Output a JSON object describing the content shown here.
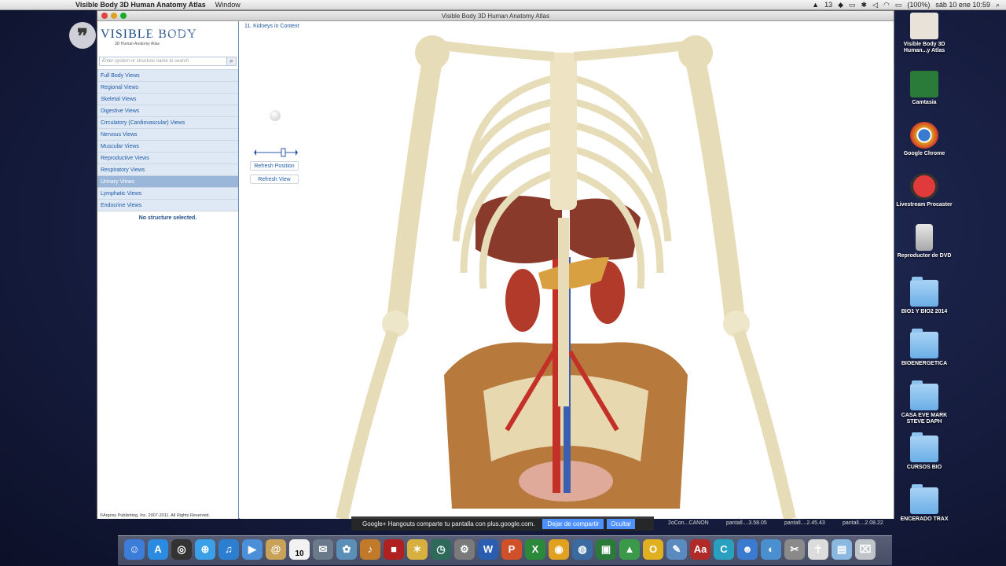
{
  "menubar": {
    "app_name": "Visible Body 3D Human Anatomy Atlas",
    "menu_window": "Window",
    "badge_count": "13",
    "battery": "(100%)",
    "datetime": "sáb 10 ene  10:59"
  },
  "window": {
    "title": "Visible Body 3D Human Anatomy Atlas"
  },
  "sidebar": {
    "logo_title": "VISIBLE BODY",
    "logo_subtitle": "3D Human Anatomy Atlas",
    "search_placeholder": "Enter system or structure name to search",
    "items": [
      {
        "label": "Full Body Views"
      },
      {
        "label": "Regional Views"
      },
      {
        "label": "Skeletal Views"
      },
      {
        "label": "Digestive Views"
      },
      {
        "label": "Circulatory (Cardiovascular) Views"
      },
      {
        "label": "Nervous Views"
      },
      {
        "label": "Muscular Views"
      },
      {
        "label": "Reproductive Views"
      },
      {
        "label": "Respiratory Views"
      },
      {
        "label": "Urinary Views"
      },
      {
        "label": "Lymphatic Views"
      },
      {
        "label": "Endocrine Views"
      }
    ],
    "active_index": 9,
    "status": "No structure selected.",
    "copyright": "©Argosy Publishing, Inc. 2007-2011. All Rights Reserved."
  },
  "viewer": {
    "breadcrumb": "11. Kidneys in Context",
    "refresh_position": "Refresh Position",
    "refresh_view": "Refresh View"
  },
  "hangouts": {
    "message": "Google+ Hangouts comparte tu pantalla con plus.google.com.",
    "stop_share": "Dejar de compartir",
    "hide": "Ocultar"
  },
  "status_strip": [
    "2oCon...CANON",
    "pantall....3.58.05",
    "pantall....2.45.43",
    "pantall....2.08.22"
  ],
  "overlay_logo": "Google+",
  "desktop_icons": [
    {
      "label": "Visible Body 3D Human...y Atlas",
      "icon": "visible-body-app-icon"
    },
    {
      "label": "Camtasia",
      "icon": "camtasia-icon"
    },
    {
      "label": "Google Chrome",
      "icon": "chrome-icon"
    },
    {
      "label": "Livestream Procaster",
      "icon": "livestream-icon"
    },
    {
      "label": "Reproductor de DVD",
      "icon": "dvd-player-icon"
    },
    {
      "label": "BIO1 Y BIO2 2014",
      "icon": "folder-icon"
    },
    {
      "label": "BIOENERGETICA",
      "icon": "folder-icon"
    },
    {
      "label": "CASA EVE MARK STEVE DAPH",
      "icon": "folder-icon"
    },
    {
      "label": "CURSOS BIO",
      "icon": "folder-icon"
    },
    {
      "label": "ENCERADO TRAX",
      "icon": "folder-icon"
    }
  ],
  "dock": {
    "calendar_day": "10",
    "items": [
      {
        "name": "finder-icon",
        "color": "#3b7dd8",
        "glyph": "☺"
      },
      {
        "name": "app-store-icon",
        "color": "#2a8be0",
        "glyph": "A"
      },
      {
        "name": "dashboard-icon",
        "color": "#333333",
        "glyph": "◎"
      },
      {
        "name": "safari-icon",
        "color": "#3aa0e8",
        "glyph": "⊕"
      },
      {
        "name": "itunes-icon",
        "color": "#2c7fd0",
        "glyph": "♫"
      },
      {
        "name": "facetime-icon",
        "color": "#4a8fd8",
        "glyph": "▶"
      },
      {
        "name": "contacts-icon",
        "color": "#c9a25a",
        "glyph": "@"
      },
      {
        "name": "calendar-icon",
        "color": "#f2f2f2",
        "glyph": ""
      },
      {
        "name": "preview-icon",
        "color": "#6a7a8a",
        "glyph": "✉"
      },
      {
        "name": "iphoto-icon",
        "color": "#5b8fb8",
        "glyph": "✿"
      },
      {
        "name": "garageband-icon",
        "color": "#c07a2a",
        "glyph": "♪"
      },
      {
        "name": "photo-booth-icon",
        "color": "#b02020",
        "glyph": "■"
      },
      {
        "name": "sketch-icon",
        "color": "#d8b040",
        "glyph": "✶"
      },
      {
        "name": "time-machine-icon",
        "color": "#2d6a5a",
        "glyph": "◷"
      },
      {
        "name": "system-preferences-icon",
        "color": "#7a7a7a",
        "glyph": "⚙"
      },
      {
        "name": "word-icon",
        "color": "#2a5db0",
        "glyph": "W"
      },
      {
        "name": "powerpoint-icon",
        "color": "#d0502a",
        "glyph": "P"
      },
      {
        "name": "excel-icon",
        "color": "#2a8a3a",
        "glyph": "X"
      },
      {
        "name": "chrome-icon",
        "color": "#e0a020",
        "glyph": "◉"
      },
      {
        "name": "network-icon",
        "color": "#3a6aa0",
        "glyph": "◍"
      },
      {
        "name": "camtasia-icon",
        "color": "#2a7a3a",
        "glyph": "▣"
      },
      {
        "name": "google-drive-icon",
        "color": "#3a9a4a",
        "glyph": "▲"
      },
      {
        "name": "ooo-icon",
        "color": "#e0b020",
        "glyph": "O"
      },
      {
        "name": "utility-icon",
        "color": "#5a8ac0",
        "glyph": "✎"
      },
      {
        "name": "dictionary-icon",
        "color": "#b02a2a",
        "glyph": "Aa"
      },
      {
        "name": "c-app-icon",
        "color": "#2aa0c0",
        "glyph": "C"
      },
      {
        "name": "messenger-icon",
        "color": "#3a7ad0",
        "glyph": "☻"
      },
      {
        "name": "globe-icon",
        "color": "#4a90d0",
        "glyph": "◐"
      },
      {
        "name": "script-icon",
        "color": "#8a8a8a",
        "glyph": "✂"
      },
      {
        "name": "visible-body-dock-icon",
        "color": "#dcdcdc",
        "glyph": "☥"
      },
      {
        "name": "applications-folder-icon",
        "color": "#8ab8e0",
        "glyph": "▤"
      },
      {
        "name": "trash-icon",
        "color": "#bfc4c8",
        "glyph": "⌧"
      }
    ]
  }
}
